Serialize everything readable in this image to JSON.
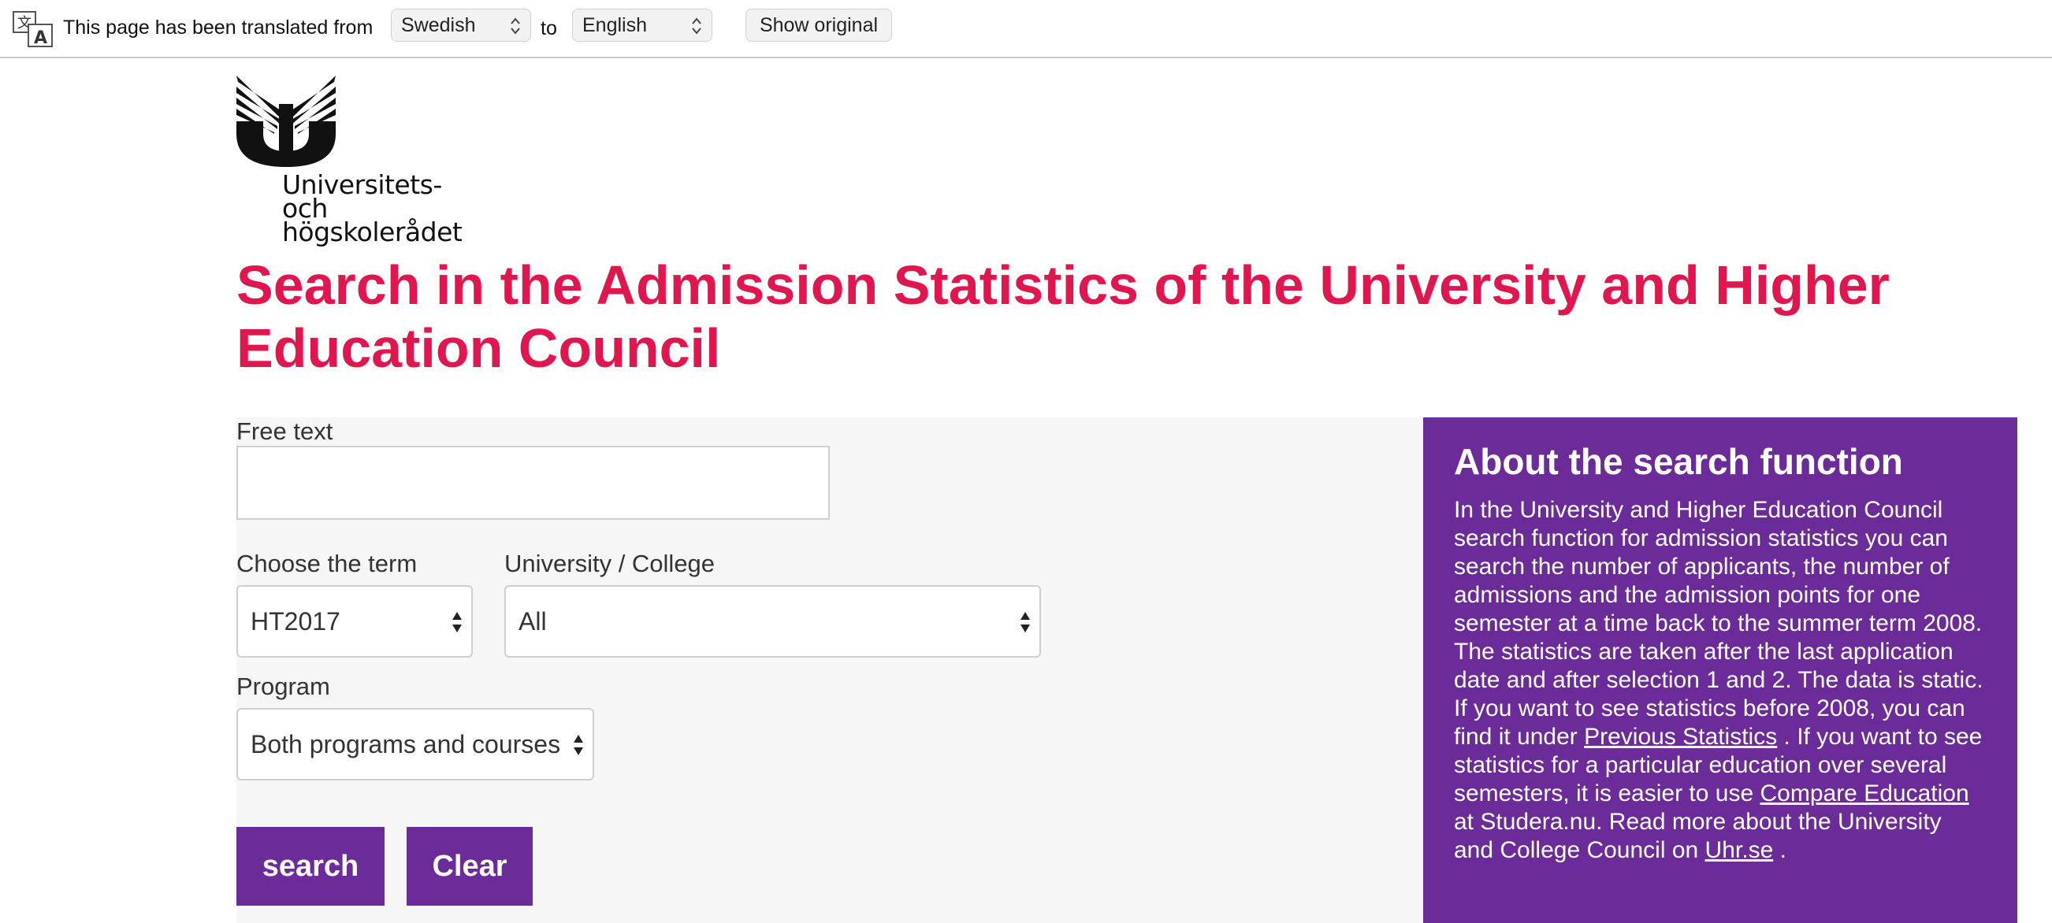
{
  "translate_bar": {
    "message": "This page has been translated from",
    "from_language": "Swedish",
    "to_label": "to",
    "to_language": "English",
    "show_original_label": "Show original",
    "icon": "translate-icon"
  },
  "logo": {
    "line1": "Universitets- och",
    "line2": "högskolerådet"
  },
  "page": {
    "title": "Search in the Admission Statistics of the University and Higher Education Council"
  },
  "form": {
    "free_text_label": "Free text",
    "free_text_value": "",
    "term_label": "Choose the term",
    "term_value": "HT2017",
    "university_label": "University / College",
    "university_value": "All",
    "program_label": "Program",
    "program_value": "Both programs and courses",
    "search_label": "search",
    "clear_label": "Clear"
  },
  "about": {
    "heading": "About the search function",
    "text_1": "In the University and Higher Education Council search function for admission statistics you can search the number of applicants, the number of admissions and the admission points for one semester at a time back to the summer term 2008. The statistics are taken after the last application date and after selection 1 and 2. The data is static. If you want to see statistics before 2008, you can find it under ",
    "link_previous": "Previous Statistics",
    "text_2": " . If you want to see statistics for a particular education over several semesters, it is easier to use ",
    "link_compare": "Compare Education",
    "text_3": " at Studera.nu. Read more about the University and College Council on ",
    "link_uhr": "Uhr.se",
    "text_4": " ."
  },
  "colors": {
    "title_red": "#e0174f",
    "brand_purple": "#6b2c99",
    "panel_gray": "#f6f6f6"
  }
}
